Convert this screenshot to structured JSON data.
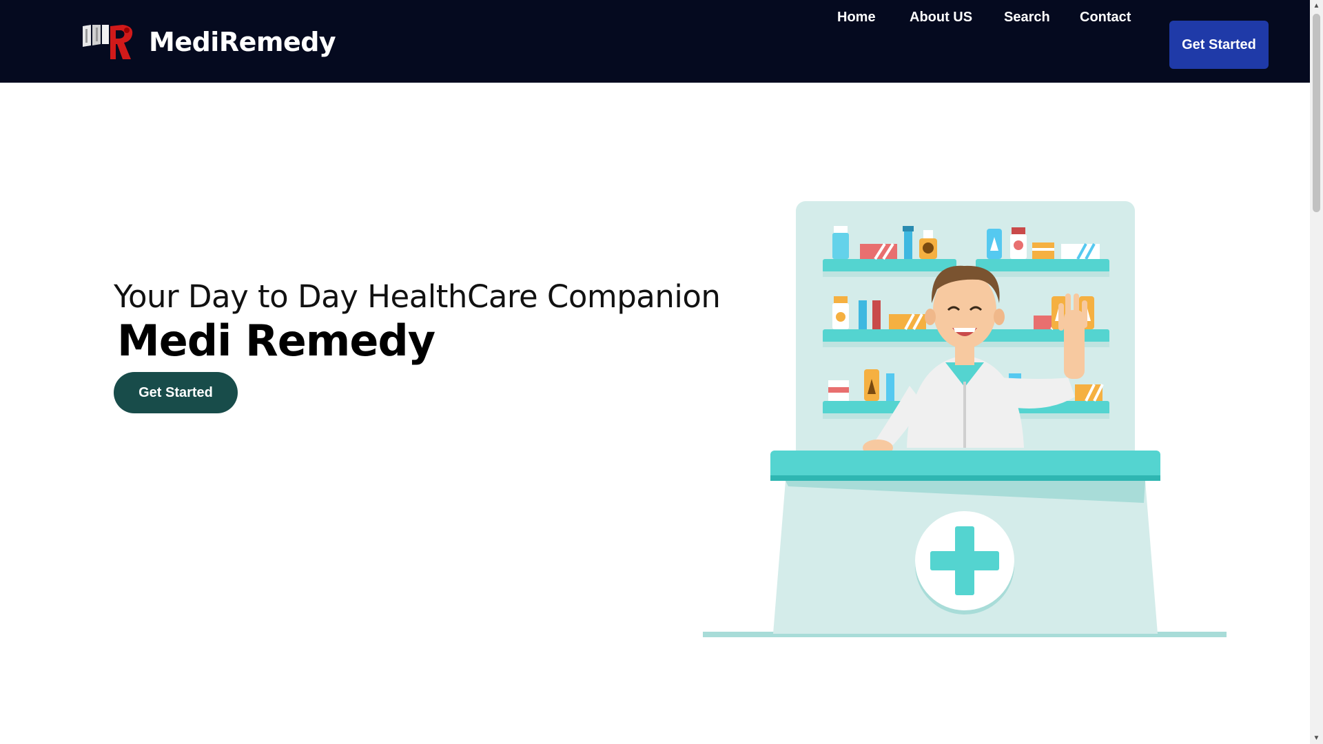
{
  "header": {
    "brand": {
      "logo_icon": "mr-logo-icon",
      "name": "MediRemedy"
    },
    "nav": [
      {
        "label": "Home"
      },
      {
        "label": "About US"
      },
      {
        "label": "Search"
      },
      {
        "label": "Contact"
      }
    ],
    "cta_label": "Get Started"
  },
  "hero": {
    "subtitle": "Your Day to Day HealthCare Companion",
    "title": "Medi Remedy",
    "cta_label": "Get Started",
    "illustration_icon": "pharmacist-illustration-icon"
  },
  "colors": {
    "header_bg": "#050a1f",
    "nav_cta_bg": "#1f3aa8",
    "hero_cta_bg": "#184c4a",
    "teal": "#54d4d0",
    "teal_light": "#d4ecea"
  }
}
